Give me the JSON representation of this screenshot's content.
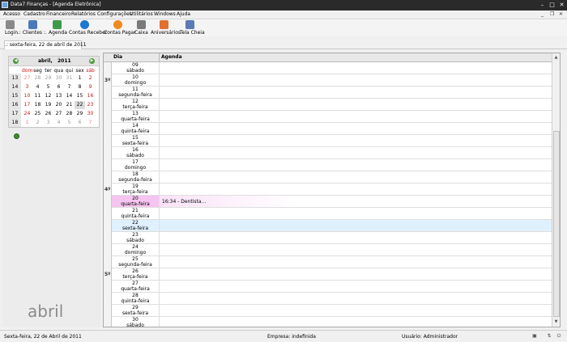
{
  "window": {
    "title": "Data7 Finanças - [Agenda Eletrônica]",
    "controls": {
      "minimize": "–",
      "maximize": "□",
      "close": "✕"
    }
  },
  "menu": {
    "items": [
      "Acesso",
      "Cadastro",
      "Financeiro",
      "Relatórios",
      "Configurações",
      "Utilitários",
      "Windows",
      "Ajuda"
    ],
    "mdi_controls": {
      "minimize": "_",
      "restore": "❐",
      "close": "✕"
    }
  },
  "toolbar": {
    "items": [
      {
        "label": "Login",
        "icon": "login-icon",
        "color": "#8a8a8a"
      },
      {
        "label": ".: Clientes :.",
        "icon": "clients-icon",
        "color": "#4a79b8"
      },
      {
        "label": "Agenda",
        "icon": "agenda-icon",
        "color": "#3d9a4a"
      },
      {
        "label": "Contas Receber",
        "icon": "receivable-icon",
        "color": "#1c78d0"
      },
      {
        "label": "Contas Pagar",
        "icon": "payable-icon",
        "color": "#f08a20"
      },
      {
        "label": "Caixa",
        "icon": "cashbox-icon",
        "color": "#7a7a7a"
      },
      {
        "label": "Aniversários",
        "icon": "birthday-icon",
        "color": "#e07030"
      },
      {
        "label": "Tela Cheia",
        "icon": "fullscreen-icon",
        "color": "#5a7ab8"
      }
    ]
  },
  "tab": {
    "label": ".: sexta-feira, 22 de abril de 2011"
  },
  "calendar": {
    "month": "abril,",
    "year": "2011",
    "prev_glyph": "◀",
    "next_glyph": "▶",
    "weekday_headers": [
      "dom",
      "seg",
      "ter",
      "qua",
      "qui",
      "sex",
      "sáb"
    ],
    "weeks": [
      {
        "week": "13",
        "days": [
          "27",
          "28",
          "29",
          "30",
          "31",
          "1",
          "2"
        ],
        "other": [
          true,
          true,
          true,
          true,
          true,
          false,
          false
        ]
      },
      {
        "week": "14",
        "days": [
          "3",
          "4",
          "5",
          "6",
          "7",
          "8",
          "9"
        ],
        "other": [
          false,
          false,
          false,
          false,
          false,
          false,
          false
        ]
      },
      {
        "week": "15",
        "days": [
          "10",
          "11",
          "12",
          "13",
          "14",
          "15",
          "16"
        ],
        "other": [
          false,
          false,
          false,
          false,
          false,
          false,
          false
        ]
      },
      {
        "week": "16",
        "days": [
          "17",
          "18",
          "19",
          "20",
          "21",
          "22",
          "23"
        ],
        "other": [
          false,
          false,
          false,
          false,
          false,
          false,
          false
        ]
      },
      {
        "week": "17",
        "days": [
          "24",
          "25",
          "26",
          "27",
          "28",
          "29",
          "30"
        ],
        "other": [
          false,
          false,
          false,
          false,
          false,
          false,
          false
        ]
      },
      {
        "week": "18",
        "days": [
          "1",
          "2",
          "3",
          "4",
          "5",
          "6",
          "7"
        ],
        "other": [
          true,
          true,
          true,
          true,
          true,
          true,
          true
        ]
      }
    ],
    "selected_day": "22"
  },
  "big_month_label": "abril",
  "agenda": {
    "columns": [
      "Dia",
      "Agenda"
    ],
    "week_labels": [
      {
        "label": "3º",
        "row": 1
      },
      {
        "label": "4º",
        "row": 10
      },
      {
        "label": "5º",
        "row": 17
      }
    ],
    "rows": [
      {
        "day": "09",
        "weekday": "sábado",
        "event": ""
      },
      {
        "day": "10",
        "weekday": "domingo",
        "event": ""
      },
      {
        "day": "11",
        "weekday": "segunda-feira",
        "event": ""
      },
      {
        "day": "12",
        "weekday": "terça-feira",
        "event": ""
      },
      {
        "day": "13",
        "weekday": "quarta-feira",
        "event": ""
      },
      {
        "day": "14",
        "weekday": "quinta-feira",
        "event": ""
      },
      {
        "day": "15",
        "weekday": "sexta-feira",
        "event": ""
      },
      {
        "day": "16",
        "weekday": "sábado",
        "event": ""
      },
      {
        "day": "17",
        "weekday": "domingo",
        "event": ""
      },
      {
        "day": "18",
        "weekday": "segunda-feira",
        "event": ""
      },
      {
        "day": "19",
        "weekday": "terça-feira",
        "event": ""
      },
      {
        "day": "20",
        "weekday": "quarta-feira",
        "event": "16:34 - Dentista..."
      },
      {
        "day": "21",
        "weekday": "quinta-feira",
        "event": ""
      },
      {
        "day": "22",
        "weekday": "sexta-feira",
        "event": ""
      },
      {
        "day": "23",
        "weekday": "sábado",
        "event": ""
      },
      {
        "day": "24",
        "weekday": "domingo",
        "event": ""
      },
      {
        "day": "25",
        "weekday": "segunda-feira",
        "event": ""
      },
      {
        "day": "26",
        "weekday": "terça-feira",
        "event": ""
      },
      {
        "day": "27",
        "weekday": "quarta-feira",
        "event": ""
      },
      {
        "day": "28",
        "weekday": "quinta-feira",
        "event": ""
      },
      {
        "day": "29",
        "weekday": "sexta-feira",
        "event": ""
      },
      {
        "day": "30",
        "weekday": "sábado",
        "event": ""
      }
    ],
    "highlighted_event_day": "20",
    "current_day": "22",
    "scroll_up_glyph": "▲",
    "scroll_down_glyph": "▼",
    "colors": {
      "event_highlight": "#f6c4f0",
      "current_row": "#dff0ff"
    }
  },
  "status": {
    "date": "Sexta-feira, 22 de Abril de 2011",
    "empresa": "Empresa: indefinida",
    "usuario": "Usuário: Administrador",
    "icons": [
      "monitor-icon",
      "network-icon",
      "exit-icon"
    ],
    "icon_glyphs": [
      "▣",
      "⇅",
      "⏻"
    ]
  }
}
